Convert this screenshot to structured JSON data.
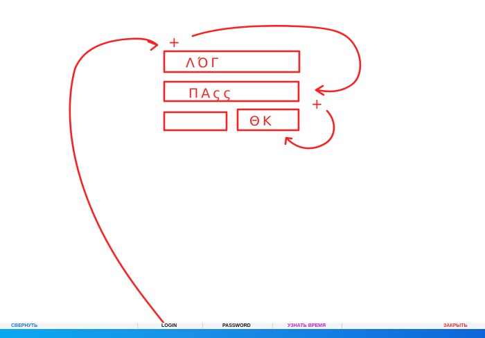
{
  "sketch": {
    "field_login_text": "ΛΌΓ",
    "field_pass_text": "ΠΑςς",
    "ok_text": "ΘK",
    "plus_mark": "+"
  },
  "taskbar": {
    "items": [
      {
        "label": "Свернуть",
        "color": "#1a73e8"
      },
      {
        "label": "LOGIN",
        "color": "#111111"
      },
      {
        "label": "PASSWORD",
        "color": "#111111"
      },
      {
        "label": "Узнать время",
        "color": "#c21fd8"
      },
      {
        "label": "Закрыть",
        "color": "#ff2a2a"
      }
    ]
  },
  "colors": {
    "ink": "#ff1f1f",
    "taskbar_blue": "#1279e0"
  }
}
